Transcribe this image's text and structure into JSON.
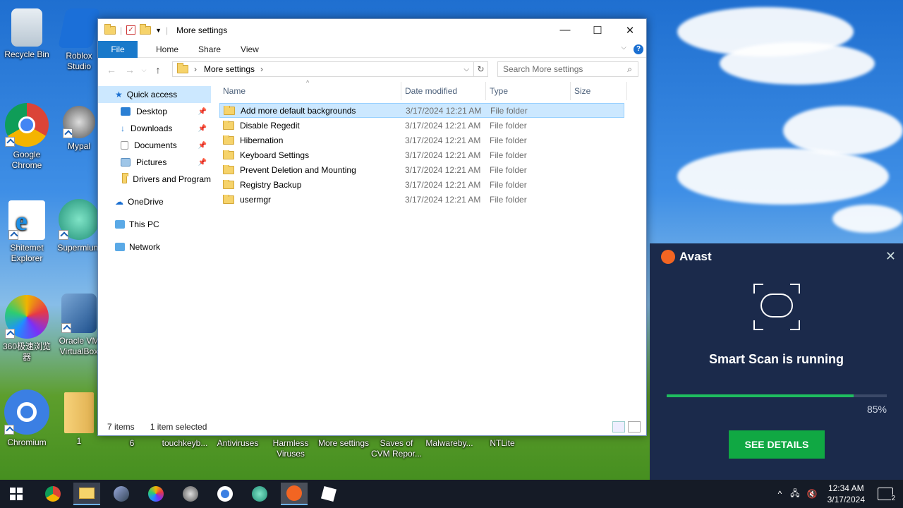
{
  "desktop": {
    "icons": [
      {
        "label": "Recycle Bin"
      },
      {
        "label": "Roblox Studio"
      },
      {
        "label": "Google Chrome"
      },
      {
        "label": "Mypal"
      },
      {
        "label": "Shitemet Explorer"
      },
      {
        "label": "Supermium"
      },
      {
        "label": "360极速浏览器"
      },
      {
        "label": "Oracle VM VirtualBox"
      },
      {
        "label": "Chromium"
      },
      {
        "label": "1"
      }
    ],
    "bottom_labels": [
      "6",
      "touchkeyb...",
      "Antiviruses",
      "Harmless Viruses",
      "More settings",
      "Saves of CVM Repor...",
      "Malwareby...",
      "NTLite"
    ]
  },
  "explorer": {
    "title": "More settings",
    "ribbon": {
      "file": "File",
      "home": "Home",
      "share": "Share",
      "view": "View",
      "help": "?"
    },
    "address": {
      "crumb": "More settings",
      "search_placeholder": "Search More settings"
    },
    "nav": [
      {
        "label": "Quick access"
      },
      {
        "label": "Desktop"
      },
      {
        "label": "Downloads"
      },
      {
        "label": "Documents"
      },
      {
        "label": "Pictures"
      },
      {
        "label": "Drivers and Program"
      },
      {
        "label": "OneDrive"
      },
      {
        "label": "This PC"
      },
      {
        "label": "Network"
      }
    ],
    "columns": {
      "name": "Name",
      "date": "Date modified",
      "type": "Type",
      "size": "Size"
    },
    "rows": [
      {
        "name": "Add more default backgrounds",
        "date": "3/17/2024 12:21 AM",
        "type": "File folder"
      },
      {
        "name": "Disable Regedit",
        "date": "3/17/2024 12:21 AM",
        "type": "File folder"
      },
      {
        "name": "Hibernation",
        "date": "3/17/2024 12:21 AM",
        "type": "File folder"
      },
      {
        "name": "Keyboard Settings",
        "date": "3/17/2024 12:21 AM",
        "type": "File folder"
      },
      {
        "name": "Prevent Deletion and Mounting",
        "date": "3/17/2024 12:21 AM",
        "type": "File folder"
      },
      {
        "name": "Registry Backup",
        "date": "3/17/2024 12:21 AM",
        "type": "File folder"
      },
      {
        "name": "usermgr",
        "date": "3/17/2024 12:21 AM",
        "type": "File folder"
      }
    ],
    "status": {
      "count": "7 items",
      "selected": "1 item selected"
    }
  },
  "avast": {
    "brand": "Avast",
    "title": "Smart Scan is running",
    "progress_percent": 85,
    "progress_label": "85%",
    "button": "SEE DETAILS",
    "accent": "#10a843",
    "bg": "#1b2a4b"
  },
  "taskbar": {
    "time": "12:34 AM",
    "date": "3/17/2024",
    "notifications": "2"
  }
}
